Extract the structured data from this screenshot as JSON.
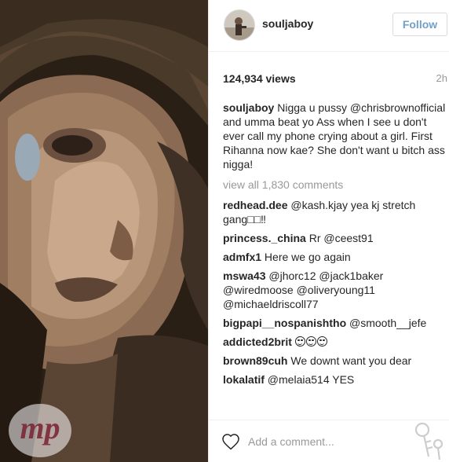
{
  "post": {
    "author": "souljaboy",
    "follow_label": "Follow",
    "views": "124,934 views",
    "time_ago": "2h",
    "caption": {
      "user": "souljaboy",
      "text": "Nigga u pussy @chrisbrownofficial and umma beat yo Ass when I see u don't ever call my phone crying about a girl. First Rihanna now kae? She don't want u bitch ass nigga!"
    },
    "view_all_comments": "view all 1,830 comments",
    "comments": [
      {
        "user": "redhead.dee",
        "text": "@kash.kjay yea kj stretch gang□□‼"
      },
      {
        "user": "princess._china",
        "text": "Rr @ceest91"
      },
      {
        "user": "admfx1",
        "text": "Here we go again"
      },
      {
        "user": "mswa43",
        "text": "@jhorc12 @jack1baker @wiredmoose @oliveryoung11 @michaeldriscoll77"
      },
      {
        "user": "bigpapi__nospanishtho",
        "text": "@smooth__jefe"
      },
      {
        "user": "addicted2brit",
        "text": "",
        "emoji_faces": 3
      },
      {
        "user": "brown89cuh",
        "text": "We downt want you dear"
      },
      {
        "user": "lokalatif",
        "text": "@melaia514 YES"
      }
    ],
    "add_comment_placeholder": "Add a comment...",
    "icons": {
      "like": "heart-outline-icon",
      "more": "key-icon"
    },
    "watermark_text": "mp"
  },
  "colors": {
    "follow_text": "#70a0c8",
    "muted": "#999999",
    "text": "#262626"
  }
}
